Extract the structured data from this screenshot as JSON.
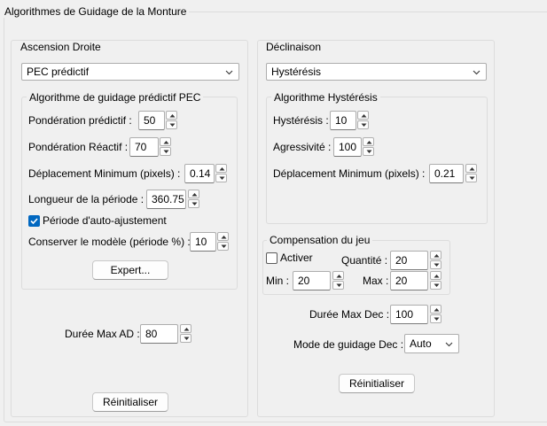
{
  "title": "Algorithmes de Guidage de la Monture",
  "ra": {
    "legend": "Ascension Droite",
    "algo_select": "PEC prédictif",
    "pec_group": {
      "legend": "Algorithme de guidage prédictif PEC",
      "predictive_weight_label": "Pondération prédictif :",
      "predictive_weight_value": "50",
      "reactive_weight_label": "Pondération Réactif :",
      "reactive_weight_value": "70",
      "min_move_label": "Déplacement Minimum (pixels) :",
      "min_move_value": "0.14",
      "period_length_label": "Longueur de la période :",
      "period_length_value": "360.75",
      "auto_adjust_label": "Période d'auto-ajustement",
      "auto_adjust_checked": true,
      "keep_model_label": "Conserver le modèle (période %) :",
      "keep_model_value": "10",
      "expert_button": "Expert..."
    },
    "max_duration_label": "Durée Max AD :",
    "max_duration_value": "80",
    "reset_button": "Réinitialiser"
  },
  "dec": {
    "legend": "Déclinaison",
    "algo_select": "Hystérésis",
    "hyst_group": {
      "legend": "Algorithme Hystérésis",
      "hysteresis_label": "Hystérésis :",
      "hysteresis_value": "10",
      "aggressiveness_label": "Agressivité :",
      "aggressiveness_value": "100",
      "min_move_label": "Déplacement Minimum (pixels) :",
      "min_move_value": "0.21"
    },
    "backlash_group": {
      "legend": "Compensation du jeu",
      "enable_label": "Activer",
      "enable_checked": false,
      "amount_label": "Quantité :",
      "amount_value": "20",
      "min_label": "Min :",
      "min_value": "20",
      "max_label": "Max :",
      "max_value": "20"
    },
    "max_duration_label": "Durée Max Dec :",
    "max_duration_value": "100",
    "guide_mode_label": "Mode de guidage Dec :",
    "guide_mode_value": "Auto",
    "reset_button": "Réinitialiser"
  }
}
